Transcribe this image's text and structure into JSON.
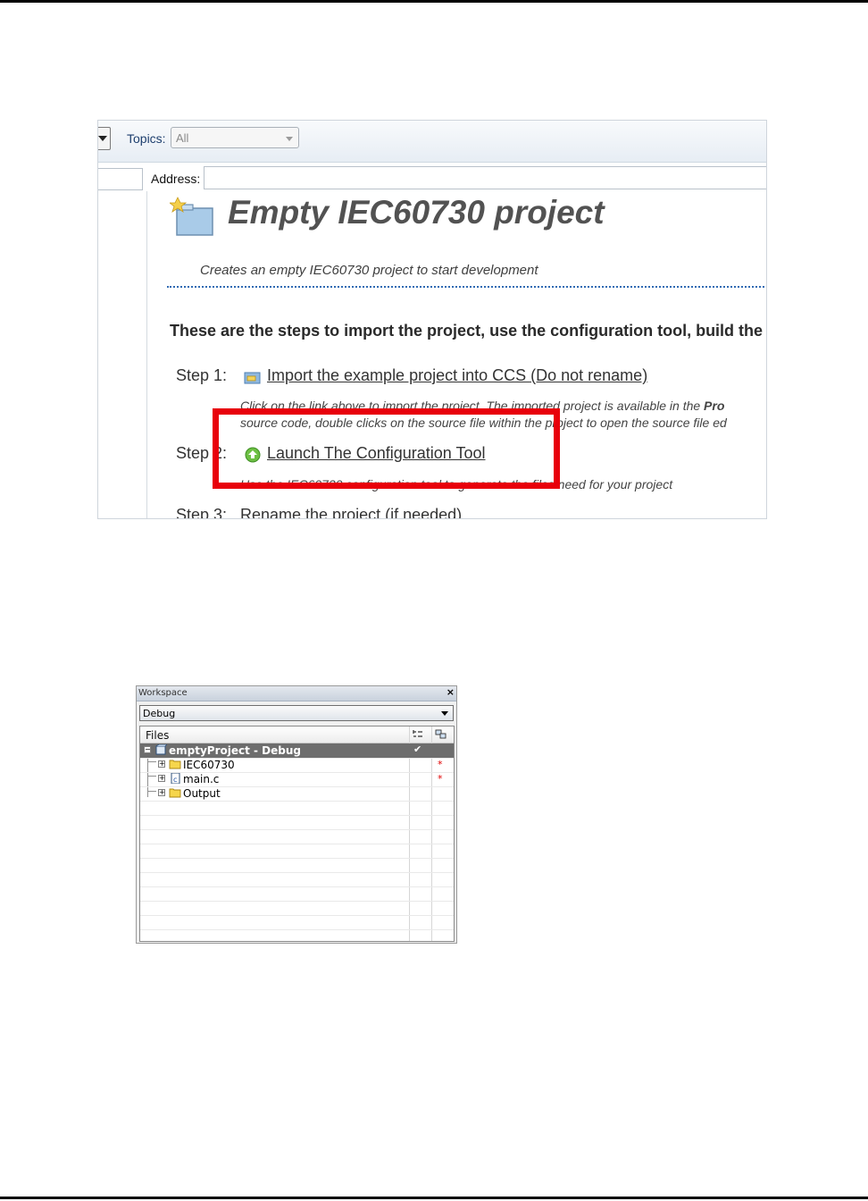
{
  "shot1": {
    "toolbar": {
      "topics_label": "Topics:",
      "topics_value": "All"
    },
    "address_label": "Address:",
    "doc": {
      "title": "Empty IEC60730 project",
      "subtitle": "Creates an empty IEC60730 project to start development",
      "intro": "These are the steps to import the project, use the configuration tool, build the",
      "steps": [
        {
          "label": "Step 1:",
          "link": "Import the example project into CCS (Do not rename)",
          "desc1": "Click on the link above to import the project. The imported project is available in the ",
          "desc1_bold": "Pro",
          "desc2": "source code, double clicks on the source file within the project to open the source file ed"
        },
        {
          "label": "Step 2:",
          "link": "Launch The Configuration Tool",
          "desc1": "Use the IEC60730 configuration tool to generate the files need for your project"
        },
        {
          "label": "Step 3:",
          "text": "Rename the project (if needed)"
        }
      ]
    },
    "colors": {
      "highlight": "#e8000b",
      "rule": "#2f6ab3"
    }
  },
  "shot2": {
    "title": "Workspace",
    "close": "×",
    "config_value": "Debug",
    "column_header": "Files",
    "rows": [
      {
        "name": "emptyProject - Debug",
        "icon": "project-icon",
        "selected": true,
        "checked": "✔",
        "modified": ""
      },
      {
        "name": "IEC60730",
        "icon": "folder-icon",
        "selected": false,
        "modified": "*"
      },
      {
        "name": "main.c",
        "icon": "c-file-icon",
        "selected": false,
        "modified": "*"
      },
      {
        "name": "Output",
        "icon": "folder-icon",
        "selected": false,
        "modified": ""
      }
    ]
  }
}
